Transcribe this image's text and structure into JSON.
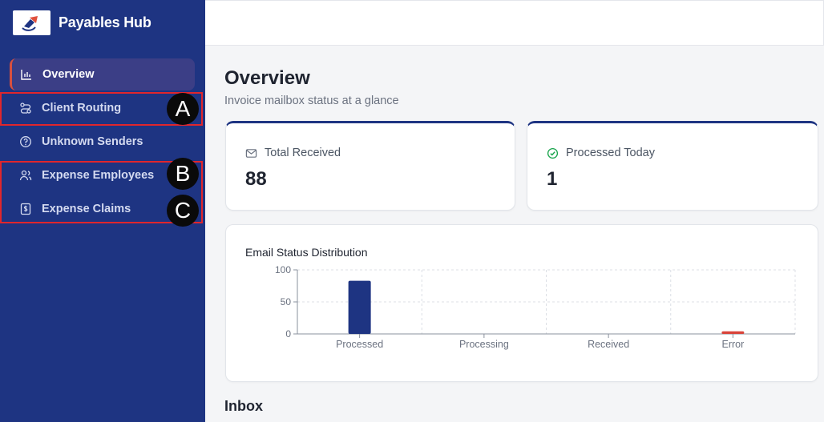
{
  "app": {
    "title": "Payables Hub"
  },
  "sidebar": {
    "items": [
      {
        "label": "Overview",
        "icon": "bar-chart-icon",
        "active": true
      },
      {
        "label": "Client Routing",
        "icon": "routing-icon"
      },
      {
        "label": "Unknown Senders",
        "icon": "help-circle-icon"
      },
      {
        "label": "Expense Employees",
        "icon": "users-icon"
      },
      {
        "label": "Expense Claims",
        "icon": "receipt-icon"
      }
    ]
  },
  "annotations": {
    "a": "A",
    "b": "B",
    "c": "C"
  },
  "page": {
    "title": "Overview",
    "subtitle": "Invoice mailbox status at a glance"
  },
  "stats": {
    "total_received": {
      "label": "Total Received",
      "value": "88"
    },
    "processed_today": {
      "label": "Processed Today",
      "value": "1"
    }
  },
  "inbox": {
    "title": "Inbox"
  },
  "colors": {
    "sidebar": "#1e3482",
    "accent": "#1e3482",
    "error": "#d9443a",
    "success": "#16a34a"
  },
  "chart_data": {
    "type": "bar",
    "title": "Email Status Distribution",
    "categories": [
      "Processed",
      "Processing",
      "Received",
      "Error"
    ],
    "values": [
      83,
      0,
      0,
      4
    ],
    "bar_colors": [
      "#1e3482",
      "#1e3482",
      "#1e3482",
      "#d9443a"
    ],
    "yticks": [
      0,
      50,
      100
    ],
    "ylim": [
      0,
      100
    ],
    "grid": true
  }
}
